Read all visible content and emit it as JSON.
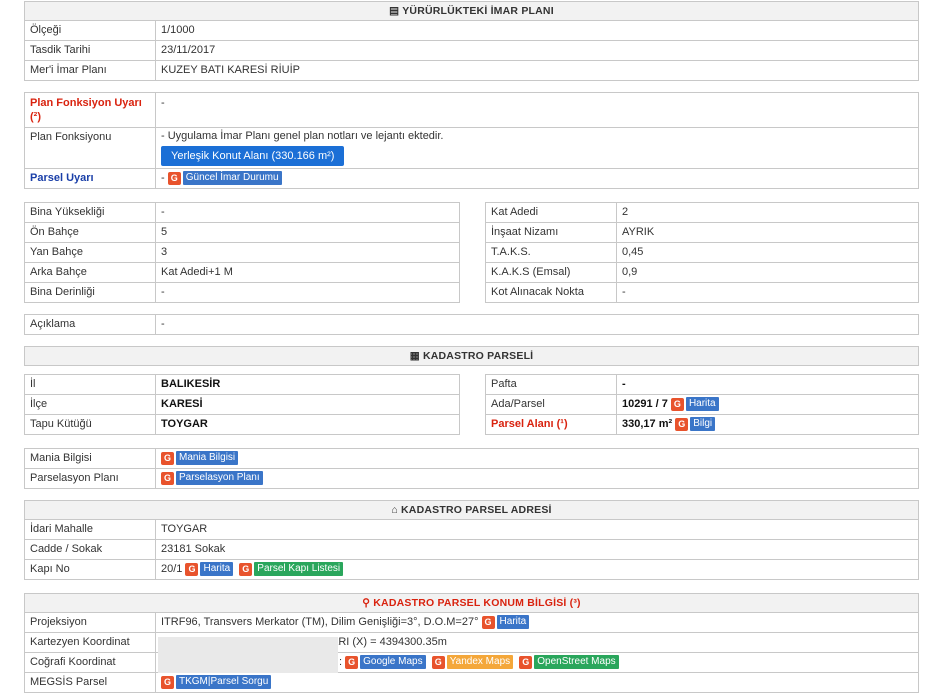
{
  "imar": {
    "title": "YÜRÜRLÜKTEKİ İMAR PLANI",
    "rows": [
      {
        "label": "Ölçeği",
        "value": "1/1000"
      },
      {
        "label": "Tasdik Tarihi",
        "value": "23/11/2017"
      },
      {
        "label": "Mer'i İmar Planı",
        "value": "KUZEY BATI KARESİ RİUİP"
      }
    ]
  },
  "plan": {
    "uyari_label": "Plan Fonksiyon Uyarı (²)",
    "uyari_value": "-",
    "fonksiyon_label": "Plan Fonksiyonu",
    "fonksiyon_text": "- Uygulama İmar Planı genel plan notları ve lejantı ektedir.",
    "fonksiyon_button": "Yerleşik Konut Alanı (330.166 m²)",
    "parsel_uyari_label": "Parsel Uyarı",
    "parsel_uyari_dash": "-",
    "guncel_button": "Güncel İmar Durumu"
  },
  "bina": {
    "left": [
      {
        "label": "Bina Yüksekliği",
        "value": "-"
      },
      {
        "label": "Ön Bahçe",
        "value": "5"
      },
      {
        "label": "Yan Bahçe",
        "value": "3"
      },
      {
        "label": "Arka Bahçe",
        "value": "Kat Adedi+1 M"
      },
      {
        "label": "Bina Derinliği",
        "value": "-"
      }
    ],
    "right": [
      {
        "label": "Kat Adedi",
        "value": "2"
      },
      {
        "label": "İnşaat Nizamı",
        "value": "AYRIK"
      },
      {
        "label": "T.A.K.S.",
        "value": "0,45"
      },
      {
        "label": "K.A.K.S (Emsal)",
        "value": "0,9"
      },
      {
        "label": "Kot Alınacak Nokta",
        "value": "-"
      }
    ]
  },
  "aciklama": {
    "label": "Açıklama",
    "value": "-"
  },
  "kadastro": {
    "title": "KADASTRO PARSELİ",
    "left": [
      {
        "label": "İl",
        "value": "BALIKESİR"
      },
      {
        "label": "İlçe",
        "value": "KARESİ"
      },
      {
        "label": "Tapu Kütüğü",
        "value": "TOYGAR"
      }
    ],
    "pafta_label": "Pafta",
    "pafta_value": "-",
    "ada_label": "Ada/Parsel",
    "ada_value": "10291 / 7",
    "alan_label": "Parsel Alanı (¹)",
    "alan_value": "330,17 m²",
    "harita_button": "Harita",
    "bilgi_button": "Bilgi"
  },
  "mania": {
    "label": "Mania Bilgisi",
    "button": "Mania Bilgisi",
    "parsel_label": "Parselasyon Planı",
    "parsel_button": "Parselasyon Planı"
  },
  "adres": {
    "title": "KADASTRO PARSEL ADRESİ",
    "mahalle_label": "İdari Mahalle",
    "mahalle_value": "TOYGAR",
    "cadde_label": "Cadde / Sokak",
    "cadde_value": "23181 Sokak",
    "kapi_label": "Kapı No",
    "kapi_value": "20/1",
    "harita_button": "Harita",
    "kapi_listesi_button": "Parsel Kapı Listesi"
  },
  "konum": {
    "title": "KADASTRO PARSEL KONUM BİLGİSİ (³)",
    "proj_label": "Projeksiyon",
    "proj_value": "ITRF96, Transvers Merkator (TM), Dilim Genişliği=3°, D.O.M=27°",
    "harita_button": "Harita",
    "kartezyen_label": "Kartezyen Koordinat",
    "kartezyen_value": "ARI (X) = 4394300.35m",
    "cografi_label": "Coğrafi Koordinat",
    "cografi_value": ":",
    "google_button": "Google Maps",
    "yandex_button": "Yandex Maps",
    "osm_button": "OpenStreet Maps",
    "megsis_label": "MEGSİS Parsel",
    "megsis_button": "TKGM|Parsel Sorgu"
  }
}
